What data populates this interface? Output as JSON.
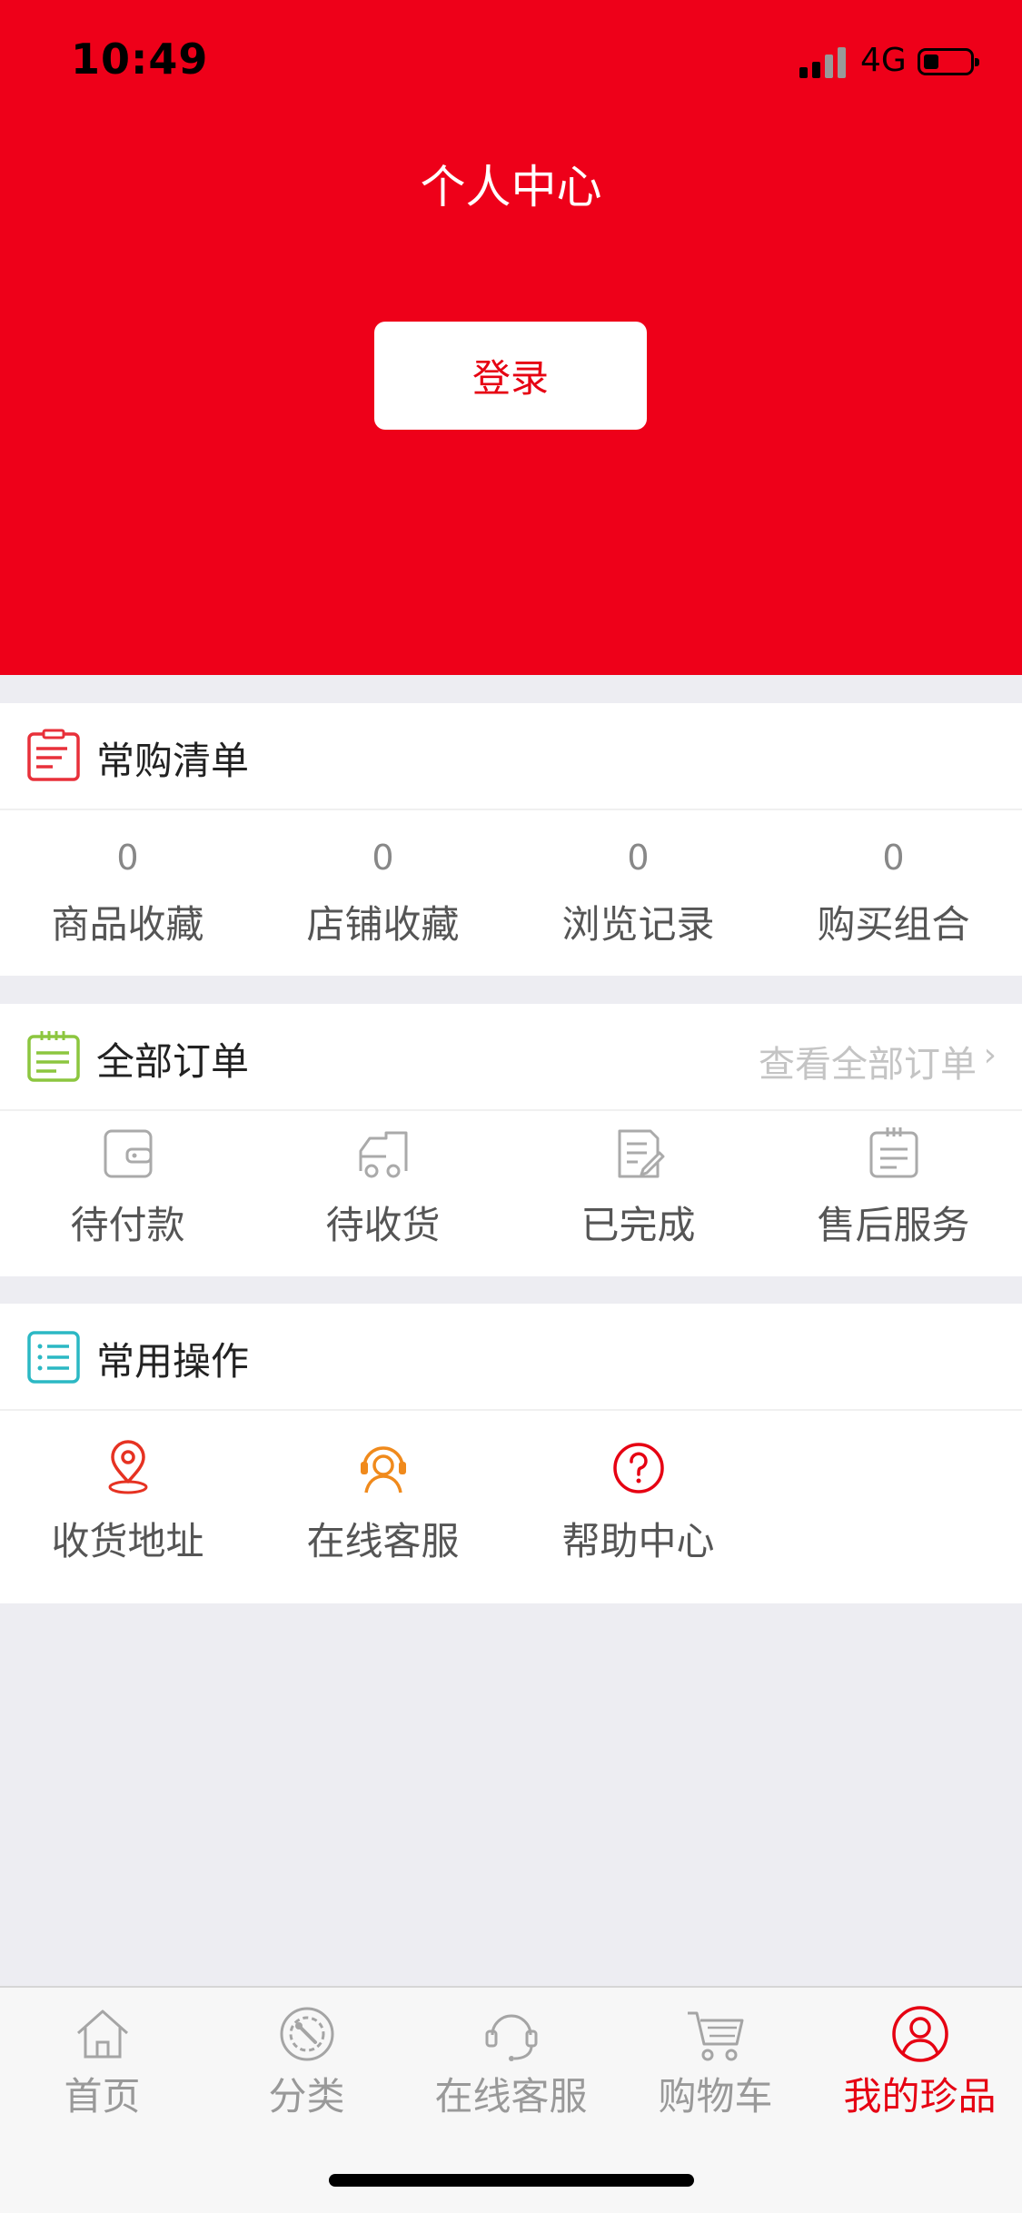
{
  "status_bar": {
    "time": "10:49",
    "network": "4G"
  },
  "header": {
    "title": "个人中心",
    "login_label": "登录"
  },
  "favorites": {
    "title": "常购清单",
    "items": [
      {
        "count": "0",
        "label": "商品收藏"
      },
      {
        "count": "0",
        "label": "店铺收藏"
      },
      {
        "count": "0",
        "label": "浏览记录"
      },
      {
        "count": "0",
        "label": "购买组合"
      }
    ]
  },
  "orders": {
    "title": "全部订单",
    "view_all": "查看全部订单",
    "items": [
      {
        "label": "待付款",
        "icon": "wallet-icon"
      },
      {
        "label": "待收货",
        "icon": "delivery-truck-icon"
      },
      {
        "label": "已完成",
        "icon": "completed-document-icon"
      },
      {
        "label": "售后服务",
        "icon": "after-sales-icon"
      }
    ]
  },
  "operations": {
    "title": "常用操作",
    "items": [
      {
        "label": "收货地址",
        "icon": "location-pin-icon"
      },
      {
        "label": "在线客服",
        "icon": "customer-service-icon"
      },
      {
        "label": "帮助中心",
        "icon": "help-icon"
      }
    ]
  },
  "tabbar": {
    "items": [
      {
        "label": "首页",
        "icon": "home-icon"
      },
      {
        "label": "分类",
        "icon": "category-icon"
      },
      {
        "label": "在线客服",
        "icon": "headset-icon"
      },
      {
        "label": "购物车",
        "icon": "cart-icon"
      },
      {
        "label": "我的珍品",
        "icon": "profile-icon",
        "active": true
      }
    ]
  },
  "colors": {
    "brand_red": "#ee0019",
    "active_tab": "#e60012",
    "favorites_icon": "#e8303a",
    "orders_icon": "#8cc63f",
    "operations_icon": "#2bb8c4",
    "customer_service_icon": "#f08a1c"
  }
}
